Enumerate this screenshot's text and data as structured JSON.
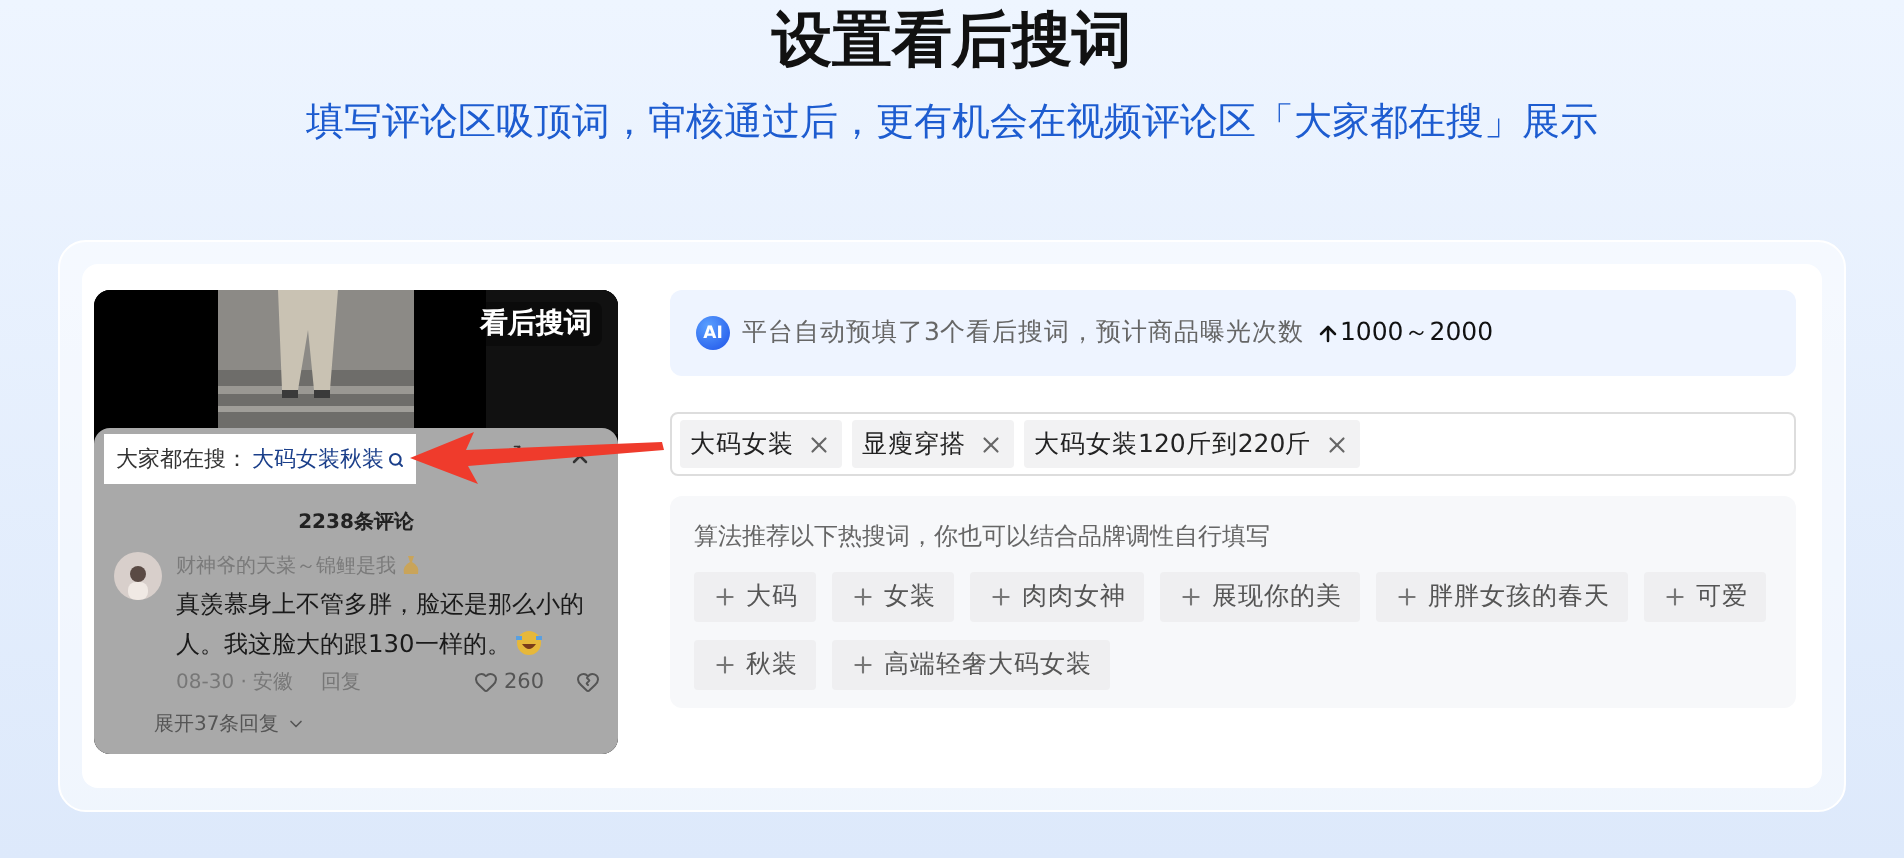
{
  "header": {
    "title": "设置看后搜词",
    "subtitle": "填写评论区吸顶词，审核通过后，更有机会在视频评论区「大家都在搜」展示"
  },
  "preview": {
    "video": {
      "kind": "picture",
      "badge": "看后搜词"
    },
    "search_bar": {
      "label": "大家都在搜：",
      "query": "大码女装秋装"
    },
    "comments": {
      "count": "2238条评论",
      "items": [
        {
          "user": "财神爷的天菜～锦鲤是我",
          "text": "真羡慕身上不管多胖，脸还是那么小的人。我这脸大的跟130一样的。",
          "date": "08-30 · 安徽",
          "reply": "回复",
          "likes": "260",
          "expand": "展开37条回复"
        }
      ]
    }
  },
  "ai_banner": {
    "badge": "AI",
    "text": "平台自动预填了3个看后搜词，预计商品曝光次数",
    "range": "1000～2000"
  },
  "selected_terms": [
    "大码女装",
    "显瘦穿搭",
    "大码女装120斤到220斤"
  ],
  "suggestions": {
    "hint": "算法推荐以下热搜词，你也可以结合品牌调性自行填写",
    "items": [
      "大码",
      "女装",
      "肉肉女神",
      "展现你的美",
      "胖胖女孩的春天",
      "可爱",
      "秋装",
      "高端轻奢大码女装"
    ]
  }
}
